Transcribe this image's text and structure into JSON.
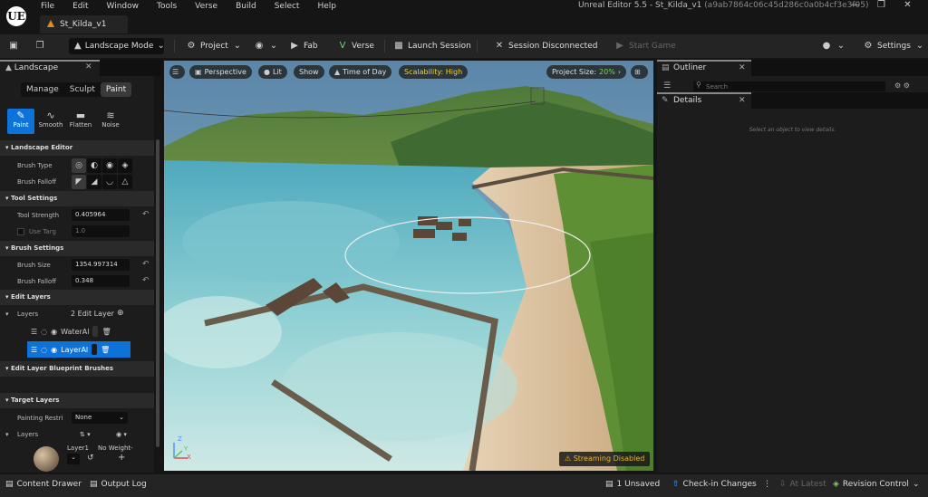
{
  "app": {
    "logo": "UE",
    "menu": [
      "File",
      "Edit",
      "Window",
      "Tools",
      "Verse",
      "Build",
      "Select",
      "Help"
    ],
    "window_title": "Unreal Editor 5.5 - St_Kilda_v1",
    "window_hash": "(a9ab7864c06c45d286c0a0b4cf3e3f05)",
    "project_tab": "St_Kilda_v1"
  },
  "toolbar": {
    "mode": "Landscape Mode",
    "project": "Project",
    "fab": "Fab",
    "verse": "Verse",
    "launch_session": "Launch Session",
    "session_status": "Session Disconnected",
    "start_game": "Start Game",
    "settings": "Settings"
  },
  "landscape_panel": {
    "tab": "Landscape",
    "modes": [
      "Manage",
      "Sculpt",
      "Paint"
    ],
    "tools": [
      "Paint",
      "Smooth",
      "Flatten",
      "Noise"
    ],
    "sections": {
      "editor": "Landscape Editor",
      "tool_settings": "Tool Settings",
      "brush_settings": "Brush Settings",
      "edit_layers": "Edit Layers",
      "blueprint_brushes": "Edit Layer Blueprint Brushes",
      "target_layers": "Target Layers"
    },
    "brush_type_label": "Brush Type",
    "brush_falloff_label": "Brush Falloff",
    "tool_strength_label": "Tool Strength",
    "tool_strength_value": "0.405964",
    "use_target_label": "Use Targ",
    "use_target_value": "1.0",
    "brush_size_label": "Brush Size",
    "brush_size_value": "1354.997314",
    "brush_falloff2_label": "Brush Falloff",
    "brush_falloff2_value": "0.348",
    "layers_label": "Layers",
    "layers_count": "2 Edit Layer",
    "edit_layers": [
      "WaterAl",
      "LayerAl"
    ],
    "painting_restriction_label": "Painting Restri",
    "painting_restriction_value": "None",
    "target_layers_label": "Layers",
    "target_layer_name": "Layer1",
    "target_layer_weight": "No Weight-"
  },
  "viewport": {
    "perspective": "Perspective",
    "lit": "Lit",
    "show": "Show",
    "time_of_day": "Time of Day",
    "scalability": "Scalability: High",
    "project_size_label": "Project Size:",
    "project_size_value": "20%",
    "streaming": "Streaming Disabled",
    "axis_x": "X",
    "axis_y": "Y",
    "axis_z": "Z"
  },
  "outliner": {
    "tab": "Outliner",
    "search_placeholder": "Search"
  },
  "details": {
    "tab": "Details",
    "empty_message": "Select an object to view details."
  },
  "statusbar": {
    "content_drawer": "Content Drawer",
    "output_log": "Output Log",
    "unsaved": "1 Unsaved",
    "check_in": "Check-in Changes",
    "at_latest": "At Latest",
    "revision_control": "Revision Control"
  },
  "colors": {
    "accent_blue": "#0e73d8",
    "scalability_yellow": "#f0d13a",
    "project_size_green": "#7bd44a",
    "warning_yellow": "#e9b73a",
    "ue_orange": "#e38c24"
  }
}
